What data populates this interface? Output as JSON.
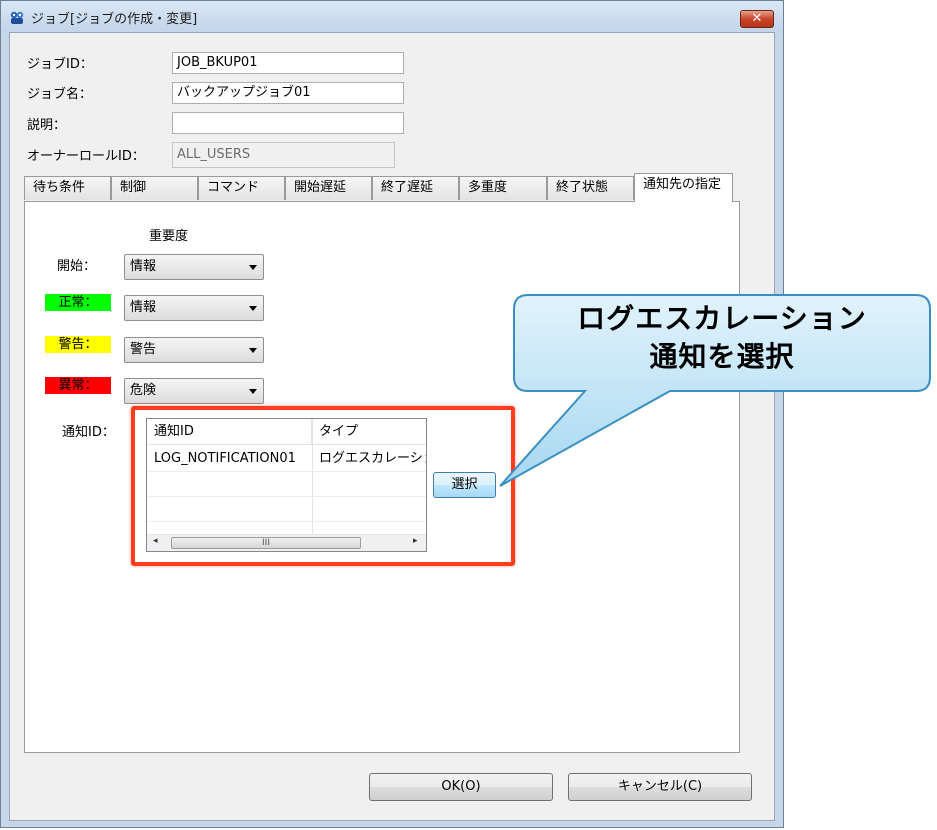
{
  "window": {
    "title": "ジョブ[ジョブの作成・変更]",
    "close_label": "✕"
  },
  "form": {
    "job_id_label": "ジョブID：",
    "job_id_value": "JOB_BKUP01",
    "job_name_label": "ジョブ名：",
    "job_name_value": "バックアップジョブ01",
    "description_label": "説明：",
    "description_value": "",
    "owner_role_label": "オーナーロールID：",
    "owner_role_value": "ALL_USERS"
  },
  "tabs": [
    {
      "label": "待ち条件"
    },
    {
      "label": "制御"
    },
    {
      "label": "コマンド"
    },
    {
      "label": "開始遅延"
    },
    {
      "label": "終了遅延"
    },
    {
      "label": "多重度"
    },
    {
      "label": "終了状態"
    },
    {
      "label": "通知先の指定",
      "active": true
    }
  ],
  "notify": {
    "severity_header": "重要度",
    "rows": [
      {
        "label": "開始：",
        "value": "情報",
        "color": ""
      },
      {
        "label": "正常：",
        "value": "情報",
        "color": "#00ff00"
      },
      {
        "label": "警告：",
        "value": "警告",
        "color": "#ffff00"
      },
      {
        "label": "異常：",
        "value": "危険",
        "color": "#ff0000"
      }
    ],
    "notify_id_label": "通知ID：",
    "table": {
      "columns": [
        "通知ID",
        "タイプ"
      ],
      "rows": [
        [
          "LOG_NOTIFICATION01",
          "ログエスカレーション"
        ]
      ],
      "scroll_grip": "III",
      "scroll_left": "◂",
      "scroll_right": "▸"
    },
    "select_button": "選択"
  },
  "footer": {
    "ok_label": "OK(O)",
    "cancel_label": "キャンセル(C)"
  },
  "callout": {
    "line1": "ログエスカレーション",
    "line2": "通知を選択"
  },
  "colors": {
    "highlight": "#ff3c1e",
    "callout_fill": "#bfe3f5",
    "callout_border": "#3a8fc0"
  }
}
